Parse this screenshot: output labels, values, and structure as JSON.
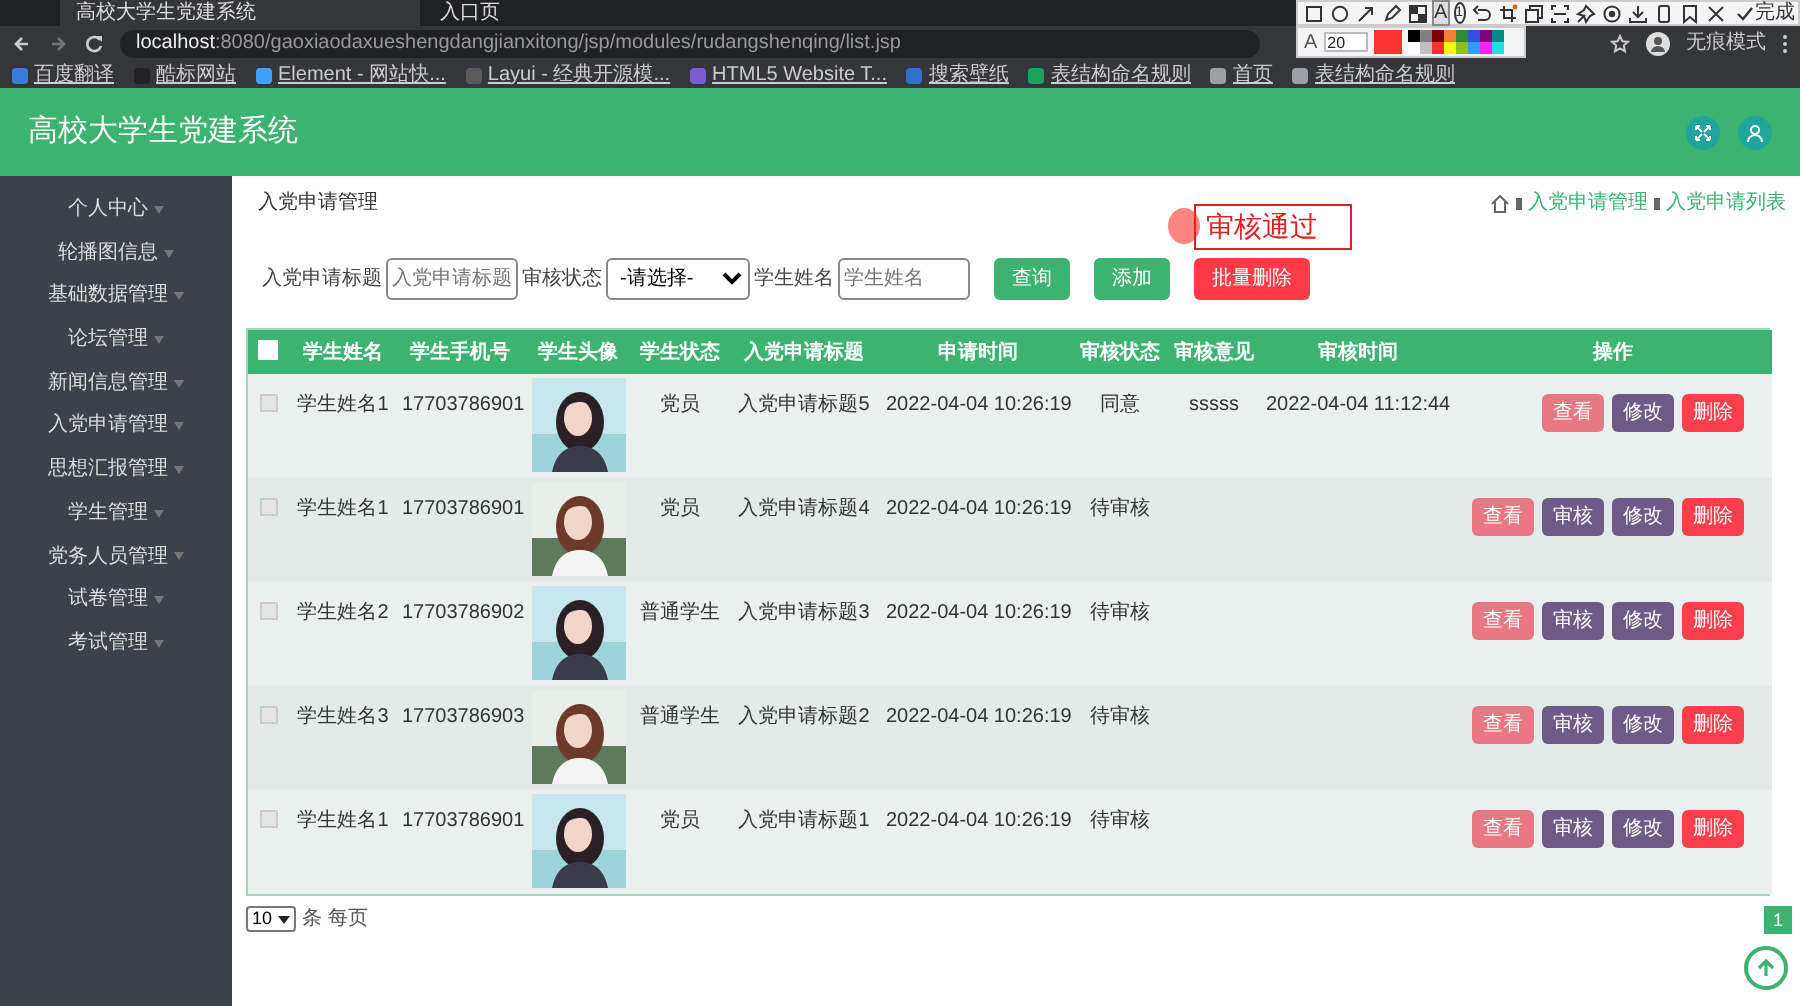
{
  "browser": {
    "tabs": [
      {
        "title": "高校大学生党建系统",
        "selected": true
      },
      {
        "title": "入口页",
        "selected": false
      }
    ],
    "url_host": "localhost",
    "url_path": ":8080/gaoxiaodaxueshengdangjianxitong/jsp/modules/rudangshenqing/list.jsp",
    "profile": "无痕模式",
    "bookmarks": [
      {
        "label": "百度翻译",
        "color": "#3b7ddd"
      },
      {
        "label": "酷标网站",
        "color": "#222222"
      },
      {
        "label": "Element - 网站快...",
        "color": "#409eff"
      },
      {
        "label": "Layui - 经典开源模...",
        "color": "#5a5a5a"
      },
      {
        "label": "HTML5 Website T...",
        "color": "#7b5cd6"
      },
      {
        "label": "搜索壁纸",
        "color": "#2f6fd0"
      },
      {
        "label": "表结构命名规则",
        "color": "#1aa260"
      },
      {
        "label": "首页",
        "color": "#9aa0a6"
      },
      {
        "label": "表结构命名规则",
        "color": "#9aa0a6"
      }
    ]
  },
  "annotation": {
    "tools": [
      {
        "kind": "rect",
        "selected": false
      },
      {
        "kind": "ellipse",
        "selected": false
      },
      {
        "kind": "arrow",
        "selected": false
      },
      {
        "kind": "pen",
        "selected": false
      },
      {
        "kind": "mosaic",
        "selected": false
      },
      {
        "kind": "text",
        "glyph": "A",
        "selected": true
      },
      {
        "kind": "number",
        "glyph": "1",
        "selected": false
      },
      {
        "kind": "undo",
        "selected": false
      },
      {
        "kind": "crop",
        "selected": false
      },
      {
        "kind": "copy",
        "selected": false
      },
      {
        "kind": "scan",
        "selected": false
      },
      {
        "kind": "pin",
        "selected": false
      },
      {
        "kind": "target",
        "selected": false
      },
      {
        "kind": "download",
        "selected": false
      },
      {
        "kind": "phone",
        "selected": false
      },
      {
        "kind": "bookmark",
        "selected": false
      },
      {
        "kind": "close",
        "selected": false
      }
    ],
    "done": "完成",
    "size_glyph": "A",
    "font_size": "20",
    "current": {
      "color": "#ff3333"
    },
    "palette": [
      {
        "color": "#000000"
      },
      {
        "color": "#808080"
      },
      {
        "color": "#800000"
      },
      {
        "color": "#f08030"
      },
      {
        "color": "#2e8b2e"
      },
      {
        "color": "#3050e0"
      },
      {
        "color": "#800080"
      },
      {
        "color": "#008b8b"
      },
      {
        "color": "#ffffff"
      },
      {
        "color": "#c0c0c0"
      },
      {
        "color": "#ff3030"
      },
      {
        "color": "#ffff00"
      },
      {
        "color": "#90c020"
      },
      {
        "color": "#30a0f0"
      },
      {
        "color": "#ff20ff"
      },
      {
        "color": "#20e0e0"
      }
    ],
    "text": "审核通过"
  },
  "app": {
    "title": "高校大学生党建系统"
  },
  "sidebar": [
    {
      "label": "个人中心"
    },
    {
      "label": "轮播图信息"
    },
    {
      "label": "基础数据管理"
    },
    {
      "label": "论坛管理"
    },
    {
      "label": "新闻信息管理"
    },
    {
      "label": "入党申请管理"
    },
    {
      "label": "思想汇报管理"
    },
    {
      "label": "学生管理"
    },
    {
      "label": "党务人员管理"
    },
    {
      "label": "试卷管理"
    },
    {
      "label": "考试管理"
    }
  ],
  "page": {
    "title": "入党申请管理",
    "breadcrumb": [
      "入党申请管理",
      "入党申请列表"
    ]
  },
  "search": {
    "fields": [
      {
        "label": "入党申请标题",
        "kind": "input",
        "placeholder": "入党申请标题"
      },
      {
        "label": "审核状态",
        "kind": "select",
        "value": "-请选择-"
      },
      {
        "label": "学生姓名",
        "kind": "input",
        "placeholder": "学生姓名"
      }
    ],
    "buttons": [
      {
        "label": "查询",
        "kind": "primary"
      },
      {
        "label": "添加",
        "kind": "primary"
      },
      {
        "label": "批量删除",
        "kind": "danger"
      }
    ]
  },
  "table": {
    "select_all": {
      "checked": false
    },
    "columns": [
      "学生姓名",
      "学生手机号",
      "学生头像",
      "学生状态",
      "入党申请标题",
      "申请时间",
      "审核状态",
      "审核意见",
      "审核时间",
      "操作"
    ],
    "rows": [
      {
        "checked": false,
        "name": "学生姓名1",
        "phone": "17703786901",
        "avatar": {
          "kind": "picture"
        },
        "status": "党员",
        "title": "入党申请标题5",
        "apply_time": "2022-04-04 10:26:19",
        "review_status": "同意",
        "review_opinion": "sssss",
        "review_time": "2022-04-04 11:12:44",
        "actions": [
          {
            "label": "查看",
            "kind": "view"
          },
          {
            "label": "修改",
            "kind": "edit"
          },
          {
            "label": "删除",
            "kind": "delete"
          }
        ]
      },
      {
        "checked": false,
        "name": "学生姓名1",
        "phone": "17703786901",
        "avatar": {
          "kind": "picture"
        },
        "status": "党员",
        "title": "入党申请标题4",
        "apply_time": "2022-04-04 10:26:19",
        "review_status": "待审核",
        "actions": [
          {
            "label": "查看",
            "kind": "view"
          },
          {
            "label": "审核",
            "kind": "review"
          },
          {
            "label": "修改",
            "kind": "edit"
          },
          {
            "label": "删除",
            "kind": "delete"
          }
        ]
      },
      {
        "checked": false,
        "name": "学生姓名2",
        "phone": "17703786902",
        "avatar": {
          "kind": "picture"
        },
        "status": "普通学生",
        "title": "入党申请标题3",
        "apply_time": "2022-04-04 10:26:19",
        "review_status": "待审核",
        "actions": [
          {
            "label": "查看",
            "kind": "view"
          },
          {
            "label": "审核",
            "kind": "review"
          },
          {
            "label": "修改",
            "kind": "edit"
          },
          {
            "label": "删除",
            "kind": "delete"
          }
        ]
      },
      {
        "checked": false,
        "name": "学生姓名3",
        "phone": "17703786903",
        "avatar": {
          "kind": "picture"
        },
        "status": "普通学生",
        "title": "入党申请标题2",
        "apply_time": "2022-04-04 10:26:19",
        "review_status": "待审核",
        "actions": [
          {
            "label": "查看",
            "kind": "view"
          },
          {
            "label": "审核",
            "kind": "review"
          },
          {
            "label": "修改",
            "kind": "edit"
          },
          {
            "label": "删除",
            "kind": "delete"
          }
        ]
      },
      {
        "checked": false,
        "name": "学生姓名1",
        "phone": "17703786901",
        "avatar": {
          "kind": "picture"
        },
        "status": "党员",
        "title": "入党申请标题1",
        "apply_time": "2022-04-04 10:26:19",
        "review_status": "待审核",
        "actions": [
          {
            "label": "查看",
            "kind": "view"
          },
          {
            "label": "审核",
            "kind": "review"
          },
          {
            "label": "修改",
            "kind": "edit"
          },
          {
            "label": "删除",
            "kind": "delete"
          }
        ]
      }
    ]
  },
  "pagination": {
    "page_size": "10",
    "suffix": "条 每页",
    "pages": [
      {
        "label": "1",
        "selected": true
      }
    ]
  }
}
